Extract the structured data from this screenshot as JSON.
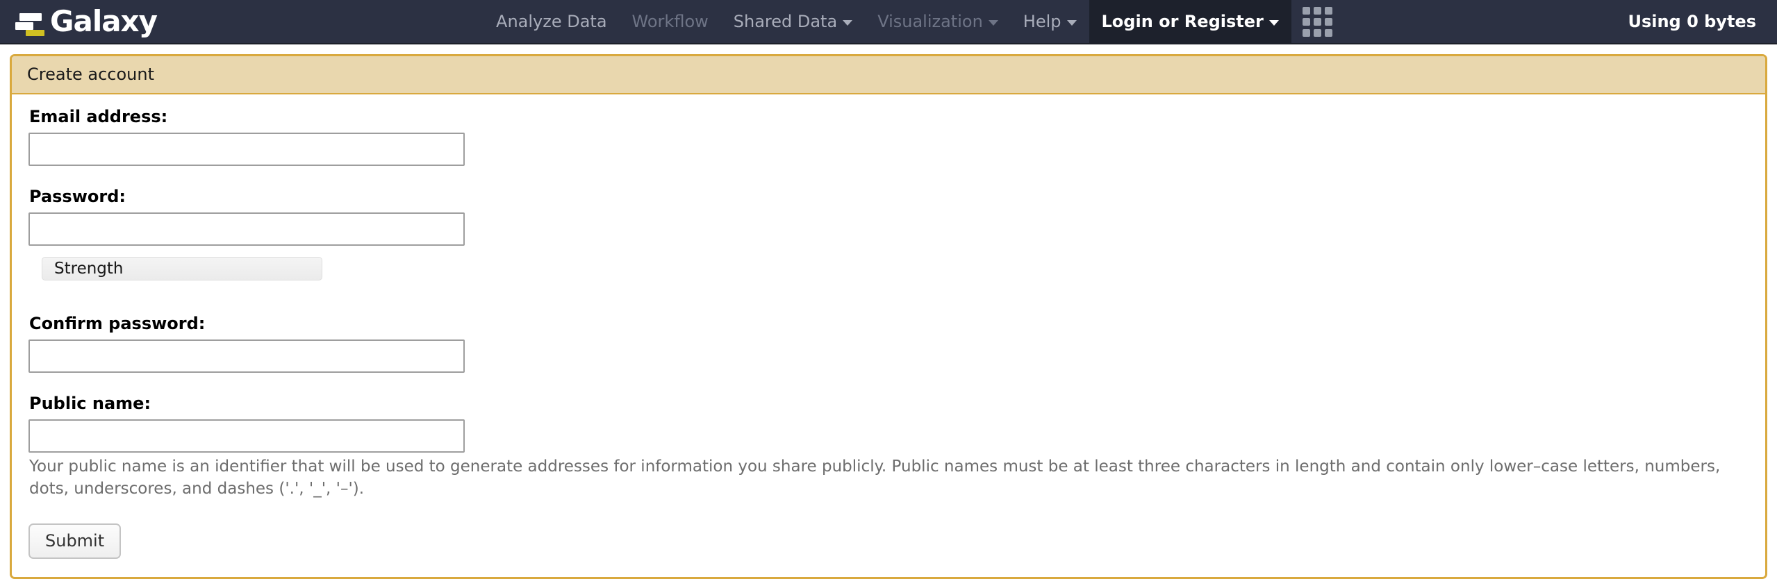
{
  "masthead": {
    "brand": "Galaxy",
    "brand_icon": "galaxy-logo-icon",
    "nav_items": [
      {
        "label": "Analyze Data",
        "state": "normal",
        "caret": false
      },
      {
        "label": "Workflow",
        "state": "dim",
        "caret": false
      },
      {
        "label": "Shared Data",
        "state": "normal",
        "caret": true
      },
      {
        "label": "Visualization",
        "state": "dim",
        "caret": true
      },
      {
        "label": "Help",
        "state": "normal",
        "caret": true
      },
      {
        "label": "Login or Register",
        "state": "active",
        "caret": true
      }
    ],
    "grid_icon": "apps-grid-icon",
    "usage": "Using 0 bytes"
  },
  "panel": {
    "title": "Create account",
    "colors": {
      "heading_background": "#e9d7ae",
      "border": "#d9a93e",
      "masthead_background": "#2c3143",
      "active_nav_background": "#1d212c"
    },
    "fields": [
      {
        "label": "Email address:",
        "value": "",
        "placeholder": "",
        "type": "text",
        "name": "email"
      },
      {
        "label": "Password:",
        "value": "",
        "placeholder": "",
        "type": "password",
        "name": "password"
      },
      {
        "label": "Confirm password:",
        "value": "",
        "placeholder": "",
        "type": "password",
        "name": "confirm-password"
      },
      {
        "label": "Public name:",
        "value": "",
        "placeholder": "",
        "type": "text",
        "name": "public-name"
      }
    ],
    "strength": {
      "label": "Strength",
      "value": 0
    },
    "public_name_help": "Your public name is an identifier that will be used to generate addresses for information you share publicly. Public names must be at least three characters in length and contain only lower–case letters, numbers, dots, underscores, and dashes ('.', '_', '–').",
    "submit_label": "Submit"
  }
}
